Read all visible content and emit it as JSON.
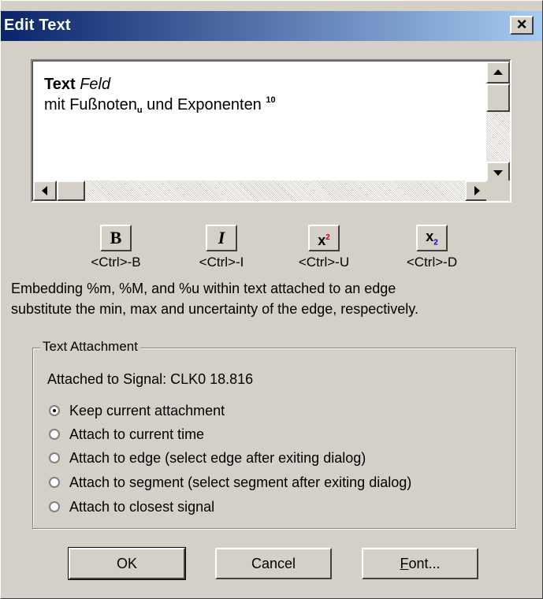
{
  "window": {
    "title": "Edit Text",
    "close_glyph": "×"
  },
  "editor": {
    "line1_bold": "Text",
    "line1_italic": "Feld",
    "line2_text": "mit Fußnoten",
    "line2_sub": "u",
    "line2_mid": "und Exponenten",
    "line2_sup": "10"
  },
  "format_buttons": [
    {
      "glyph": "B",
      "shortcut": "<Ctrl>-B",
      "icon": "bold-icon"
    },
    {
      "glyph": "I",
      "shortcut": "<Ctrl>-I",
      "icon": "italic-icon"
    },
    {
      "glyph": "x",
      "shortcut": "<Ctrl>-U",
      "icon": "superscript-icon"
    },
    {
      "glyph": "x",
      "shortcut": "<Ctrl>-D",
      "icon": "subscript-icon"
    }
  ],
  "info": {
    "line1": "Embedding %m, %M, and %u  within text attached to an edge",
    "line2": "substitute the min, max and uncertainty of the edge, respectively."
  },
  "attachment": {
    "legend": "Text Attachment",
    "attached_to": "Attached to Signal: CLK0 18.816",
    "options": [
      {
        "label": "Keep current attachment",
        "selected": true
      },
      {
        "label": "Attach to current time",
        "selected": false
      },
      {
        "label": "Attach to edge (select edge after exiting dialog)",
        "selected": false
      },
      {
        "label": "Attach to segment (select segment after exiting dialog)",
        "selected": false
      },
      {
        "label": "Attach to closest signal",
        "selected": false
      }
    ]
  },
  "buttons": {
    "ok": "OK",
    "cancel": "Cancel",
    "font": "Font..."
  },
  "colors": {
    "titlebar_start": "#0a246a",
    "titlebar_end": "#a6caf0",
    "dialog_bg": "#d4d0c8"
  }
}
